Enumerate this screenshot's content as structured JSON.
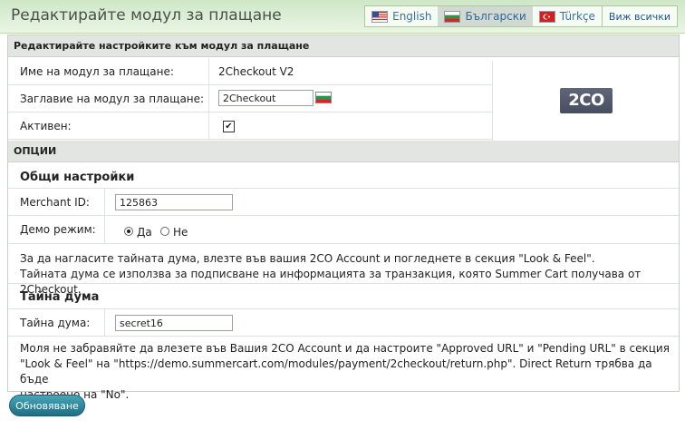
{
  "page": {
    "title": "Редактирайте модул за плащане"
  },
  "languages": {
    "items": [
      {
        "label": "English",
        "flag": "us-flag-icon",
        "active": false
      },
      {
        "label": "Български",
        "flag": "bg-flag-icon",
        "active": true
      },
      {
        "label": "Türkçe",
        "flag": "tr-flag-icon",
        "active": false
      }
    ],
    "view_all": "Виж всички"
  },
  "settings": {
    "heading": "Редактирайте настройките към модул за плащане",
    "module_name_label": "Име на модул за плащане:",
    "module_name_value": "2Checkout V2",
    "module_title_label": "Заглавие на модул за плащане:",
    "module_title_value": "2Checkout",
    "active_label": "Активен:",
    "active_checked": true,
    "logo_text": "2CO"
  },
  "options": {
    "heading": "ОПЦИИ",
    "general_title": "Общи настройки",
    "merchant_id_label": "Merchant ID:",
    "merchant_id_value": "125863",
    "demo_mode_label": "Демо режим:",
    "demo_yes": "Да",
    "demo_no": "Не",
    "demo_selected": "Да",
    "note1_line1": "За да нагласите тайната дума, влезте във вашия 2CO Account и погледнете в секция \"Look & Feel\".",
    "note1_line2": "Тайната дума се използва за подписване на информацията за транзакция, която Summer Cart получава от 2Checkout.",
    "secret_title": "Тайна дума",
    "secret_label": "Тайна дума:",
    "secret_value": "secret16",
    "note2_line1": "Моля не забравяйте да влезете във Вашия 2CO Account и да настроите \"Approved URL\" и \"Pending URL\" в секция",
    "note2_line2": "\"Look & Feel\" на \"https://demo.summercart.com/modules/payment/2checkout/return.php\". Direct Return трябва да бъде",
    "note2_line3": "настроено на \"No\"."
  },
  "actions": {
    "update_label": "Обновяване"
  },
  "colors": {
    "header_bg": "#d6ecce",
    "section_bg": "#e2e5e2",
    "button": "#2a8aa0",
    "link": "#3a6fa5"
  }
}
